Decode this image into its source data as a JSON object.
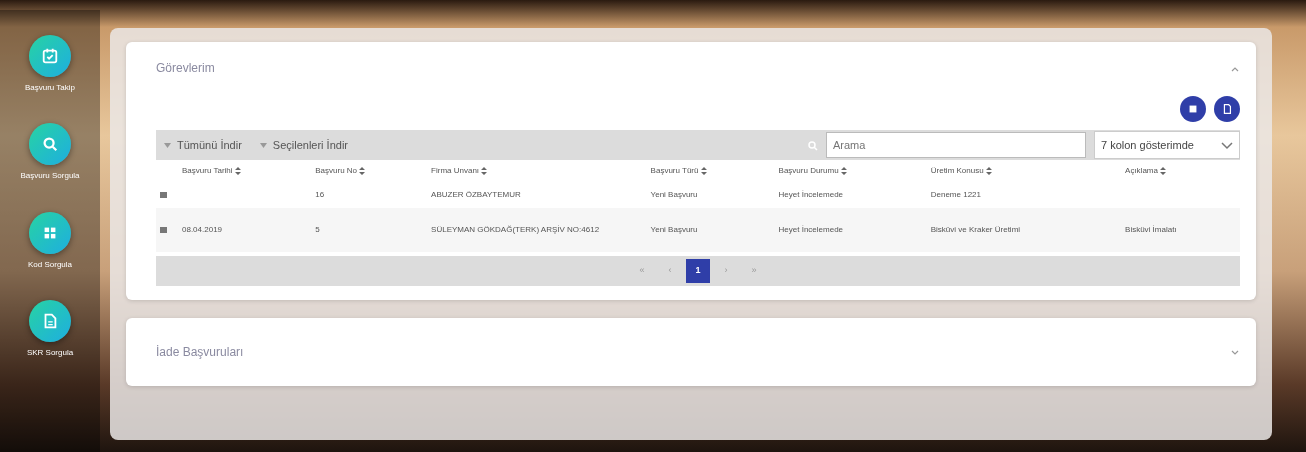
{
  "sidebar": {
    "items": [
      {
        "label": "Başvuru Takip"
      },
      {
        "label": "Başvuru Sorgula"
      },
      {
        "label": "Kod Sorgula"
      },
      {
        "label": "SKR Sorgula"
      }
    ]
  },
  "panels": [
    {
      "title": "Görevlerim",
      "expanded": true,
      "table": {
        "toolbar": {
          "download_all": "Tümünü İndir",
          "download_selected": "Seçilenleri İndir",
          "search": {
            "placeholder": "Arama"
          },
          "columns_select": "7 kolon gösterimde"
        },
        "columns": [
          "Başvuru Tarihi",
          "Başvuru No",
          "Firma Unvanı",
          "Başvuru Türü",
          "Başvuru Durumu",
          "Üretim Konusu",
          "Açıklama"
        ],
        "rows": [
          [
            "",
            "16",
            "ABUZER ÖZBAYTEMUR",
            "Yeni Başvuru",
            "Heyet İncelemede",
            "Deneme 1221",
            ""
          ],
          [
            "08.04.2019",
            "5",
            "SÜLEYMAN GÖKDAĞ(TERK) ARŞİV NO:4612",
            "Yeni Başvuru",
            "Heyet İncelemede",
            "Bisküvi ve Kraker Üretimi",
            "Bisküvi İmalatı"
          ]
        ],
        "pagination": [
          {
            "label": "«",
            "selected": false
          },
          {
            "label": "‹",
            "selected": false
          },
          {
            "label": "1",
            "selected": true
          },
          {
            "label": "›",
            "selected": false
          },
          {
            "label": "»",
            "selected": false
          }
        ]
      }
    },
    {
      "title": "İade Başvuruları",
      "expanded": false
    }
  ]
}
